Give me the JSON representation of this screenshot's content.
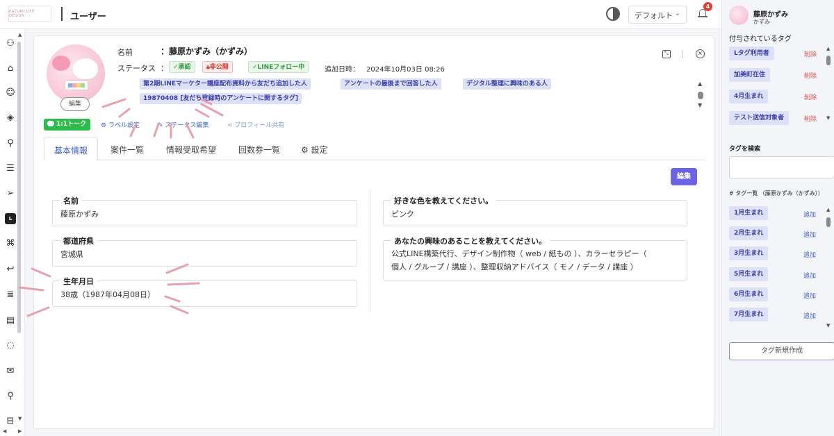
{
  "header": {
    "logo_text": "KAZUMI LIFE DESIGN",
    "page_title": "ユーザー",
    "view_select": "デフォルト",
    "notification_count": "4"
  },
  "leftnav": {
    "icons": [
      "users-icon",
      "tag-icon",
      "smile-icon",
      "rocket-icon",
      "user-settings-icon",
      "news-icon",
      "send-icon",
      "line-icon",
      "sitemap-icon",
      "reply-icon",
      "list-icon",
      "document-icon",
      "chat-icon",
      "mail-icon",
      "pin-icon",
      "bus-icon"
    ]
  },
  "profile": {
    "avatar_edit_label": "編集",
    "name_label": "名前",
    "name_value": "：藤原かずみ（かずみ）",
    "status_label": "ステータス",
    "status_sep": "：",
    "status_approved": "✓承認",
    "status_private": "非公開",
    "status_line_follow": "✓LINEフォロー中",
    "added_label": "追加日時：",
    "added_value": "2024年10月03日 08:26",
    "tags": [
      "第2期LINEマーケター講座配布資料から友だち追加した人",
      "アンケートの最後まで回答した人",
      "デジタル整理に興味のある人",
      "19870408 [友だち登録時のアンケートに関するタグ]"
    ]
  },
  "actions": {
    "line_talk": "1:1トーク",
    "label_settings": "ラベル設定",
    "status_edit": "ステータス編集",
    "profile_share": "プロフィール共有"
  },
  "tabs": [
    "基本情報",
    "案件一覧",
    "情報受取希望",
    "回数券一覧",
    "設定"
  ],
  "edit_button": "編集",
  "fields": {
    "name": {
      "label": "名前",
      "value": "藤原かずみ"
    },
    "prefecture": {
      "label": "都道府県",
      "value": "宮城県"
    },
    "birthday": {
      "label": "生年月日",
      "value": "38歳（1987年04月08日）"
    },
    "favorite_color": {
      "label": "好きな色を教えてください。",
      "value": "ピンク"
    },
    "interests": {
      "label": "あなたの興味のあることを教えてください。",
      "value_line1": "公式LINE構築代行、デザイン制作物（ web / 紙もの ）、カラーセラピー（",
      "value_line2": "個人 / グループ / 講座 ）、整理収納アドバイス（ モノ / データ / 講座 ）"
    }
  },
  "right_panel": {
    "user_name": "藤原かずみ",
    "user_kana": "かずみ",
    "assigned_heading": "付与されているタグ",
    "assigned_tags": [
      "Lタグ利用者",
      "加美町在住",
      "4月生まれ",
      "テスト送信対象者"
    ],
    "delete_label": "削除",
    "search_label": "タグを検索",
    "search_value": "",
    "taglist_heading": "# タグ一覧 （藤原かずみ（かずみ））",
    "available_tags": [
      "1月生まれ",
      "2月生まれ",
      "3月生まれ",
      "5月生まれ",
      "6月生まれ",
      "7月生まれ"
    ],
    "add_label": "追加",
    "new_tag_button": "タグ新規作成"
  },
  "colors": {
    "accent": "#3e64c6",
    "primary_button": "#6c63e6",
    "line_green": "#2dbb4c",
    "tag_bg": "#dde1f8",
    "delete_red": "#d9534f",
    "annotation_pink": "#e8a0ad"
  }
}
